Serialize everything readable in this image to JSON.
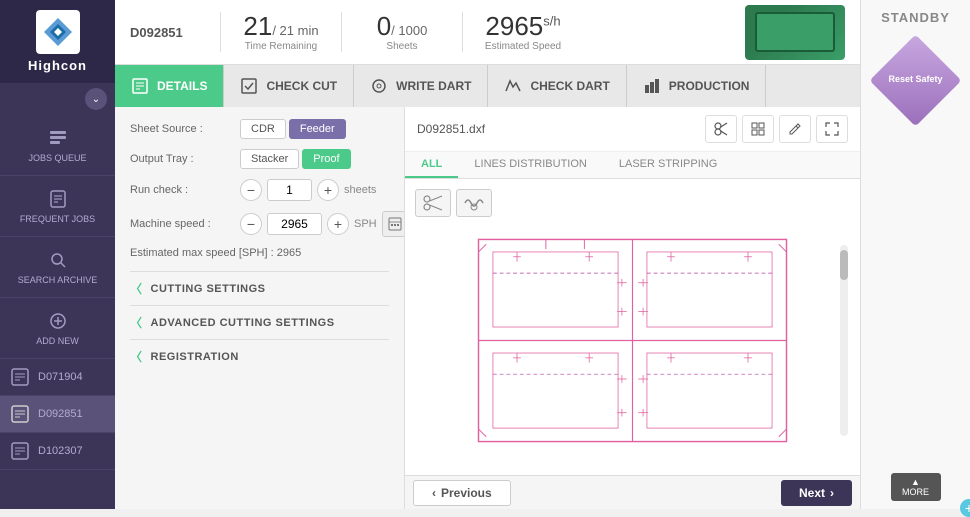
{
  "app": {
    "name": "Highcon",
    "status": "STANDBY"
  },
  "topbar": {
    "job_id": "D092851",
    "time_remaining_value": "21",
    "time_remaining_fraction": "/ 21 min",
    "time_remaining_label": "Time Remaining",
    "sheets_value": "0",
    "sheets_fraction": "/ 1000",
    "sheets_label": "Sheets",
    "speed_value": "2965",
    "speed_unit": "s/h",
    "speed_label": "Estimated Speed"
  },
  "tabs": [
    {
      "id": "details",
      "label": "DETAILS",
      "active": true
    },
    {
      "id": "check-cut",
      "label": "CHECK CUT",
      "active": false
    },
    {
      "id": "write-dart",
      "label": "WRITE DART",
      "active": false
    },
    {
      "id": "check-dart",
      "label": "CHECK DART",
      "active": false
    },
    {
      "id": "production",
      "label": "PRODUCTION",
      "active": false
    }
  ],
  "sidebar": {
    "items": [
      {
        "id": "jobs-queue",
        "label": "JOBS QUEUE"
      },
      {
        "id": "frequent-jobs",
        "label": "FREQUENT JOBS"
      },
      {
        "id": "search-archive",
        "label": "SEARCH ARCHIVE"
      },
      {
        "id": "add-new",
        "label": "ADD NEW"
      }
    ],
    "jobs": [
      {
        "id": "D071904",
        "active": false
      },
      {
        "id": "D092851",
        "active": true
      },
      {
        "id": "D102307",
        "active": false
      }
    ]
  },
  "form": {
    "sheet_source_label": "Sheet Source :",
    "sheet_source_options": [
      "CDR",
      "Feeder"
    ],
    "sheet_source_active": "Feeder",
    "output_tray_label": "Output Tray :",
    "output_tray_options": [
      "Stacker",
      "Proof"
    ],
    "output_tray_active": "Proof",
    "run_check_label": "Run check :",
    "run_check_value": "1",
    "run_check_unit": "sheets",
    "machine_speed_label": "Machine speed :",
    "machine_speed_value": "2965",
    "machine_speed_unit": "SPH",
    "est_speed_label": "Estimated max speed [SPH] :",
    "est_speed_value": "2965"
  },
  "sections": [
    {
      "label": "CUTTING SETTINGS"
    },
    {
      "label": "ADVANCED CUTTING SETTINGS"
    },
    {
      "label": "REGISTRATION"
    }
  ],
  "preview": {
    "filename": "D092851.dxf",
    "tabs": [
      "ALL",
      "LINES DISTRIBUTION",
      "LASER STRIPPING"
    ],
    "active_tab": "ALL"
  },
  "nav": {
    "previous_label": "Previous",
    "next_label": "Next"
  },
  "reset_safety": "Reset Safety",
  "more_label": "MORE"
}
